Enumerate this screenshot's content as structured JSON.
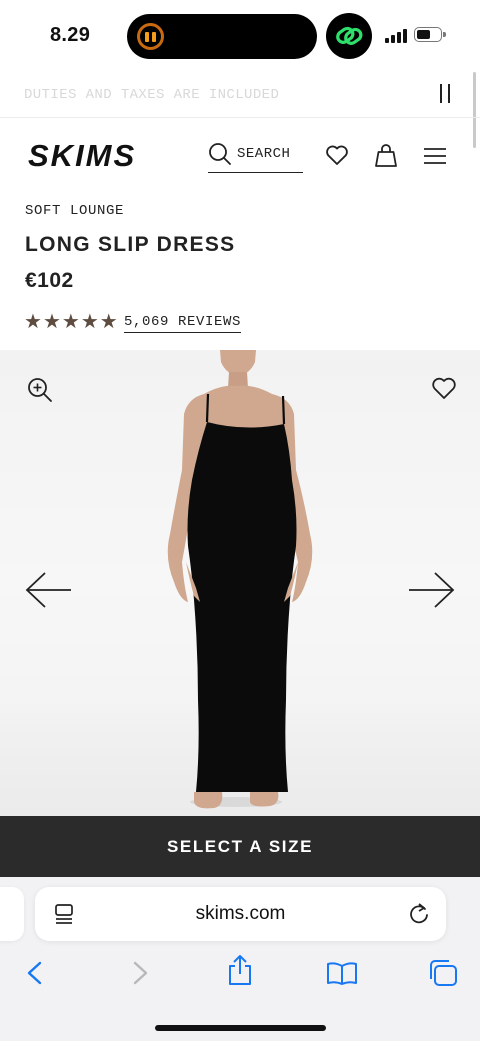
{
  "status_bar": {
    "time": "8.29"
  },
  "announcement": {
    "text": "DUTIES AND TAXES ARE INCLUDED"
  },
  "header": {
    "logo_text": "SKIMS",
    "search_label": "SEARCH"
  },
  "product": {
    "collection": "SOFT LOUNGE",
    "name": "LONG SLIP DRESS",
    "price": "€102",
    "rating": 5,
    "reviews_label": "5,069 REVIEWS",
    "dress_color": "#0b0b0b"
  },
  "cta": {
    "label": "SELECT A SIZE"
  },
  "browser": {
    "url": "skims.com"
  },
  "colors": {
    "accent_star": "#5d4c3f",
    "cta_bg": "#2b2b2b",
    "ios_blue": "#1877f2"
  }
}
